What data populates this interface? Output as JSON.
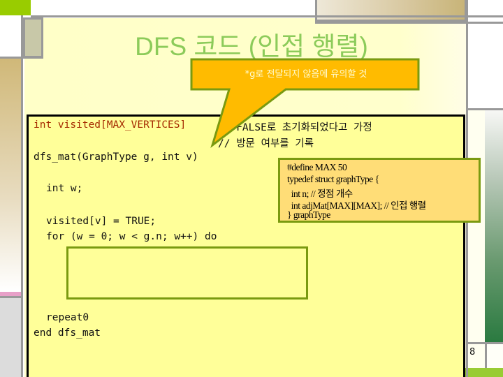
{
  "slide": {
    "title": "DFS 코드 (인접 행렬)",
    "page_number": "8",
    "colors": {
      "title": "#8ccb5a",
      "slide_background": "#ffffcc",
      "code_background": "#ffff99",
      "callout_fill": "#ffbb00",
      "callout_border": "#7a9a10",
      "struct_box_fill": "#ffdd77",
      "accent_green": "#99cc00"
    }
  },
  "callout": {
    "text": "*g로 전달되지 않음에 유의할 것"
  },
  "code": {
    "line1_code": "int visited[MAX_VERTICES]",
    "line1_comment": "// FALSE로 초기화되었다고 가정",
    "line2_comment": "// 방문 여부를 기록",
    "line3": "dfs_mat(GraphType g, int v)",
    "line4": "int w;",
    "line5": "visited[v] = TRUE;",
    "line6": "for (w = 0; w < g.n; w++) do",
    "line7": "repeat0",
    "line8": "end dfs_mat"
  },
  "struct_box": {
    "lines": [
      "#define MAX 50",
      "typedef struct graphType {",
      "  int n; // 정점 개수",
      "  int adjMat[MAX][MAX]; // 인접 행렬",
      "} graphType"
    ]
  }
}
